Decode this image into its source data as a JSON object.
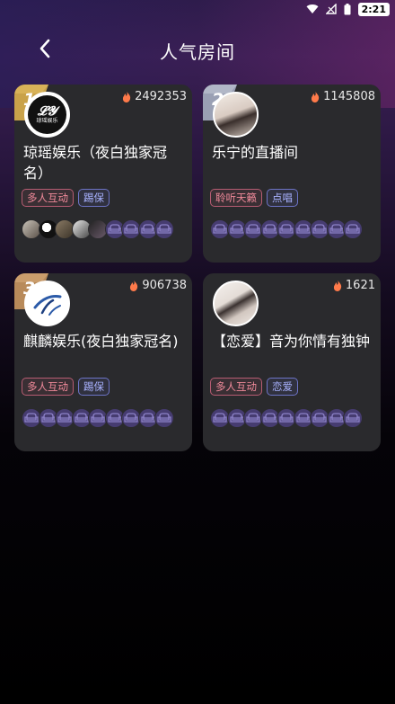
{
  "status_bar": {
    "time": "2:21"
  },
  "header": {
    "title": "人气房间"
  },
  "rooms": [
    {
      "rank": "1",
      "heat": "2492353",
      "title": "琼瑶娱乐（夜白独家冠名）",
      "tags": [
        "多人互动",
        "踢保"
      ],
      "avatar_text": "琼瑶娱乐"
    },
    {
      "rank": "2",
      "heat": "1145808",
      "title": "乐宁的直播间",
      "tags": [
        "聆听天籁",
        "点唱"
      ]
    },
    {
      "rank": "3",
      "heat": "906738",
      "title": "麒麟娱乐(夜白独家冠名)",
      "tags": [
        "多人互动",
        "踢保"
      ]
    },
    {
      "rank": "",
      "heat": "1621",
      "title": "【恋爱】音为你情有独钟",
      "tags": [
        "多人互动",
        "恋爱"
      ]
    }
  ],
  "icons": {
    "back": "chevron-left-icon",
    "heat": "flame-icon",
    "seat": "sofa-seat-icon",
    "wifi": "wifi-icon",
    "signal": "signal-icon",
    "battery": "battery-icon"
  },
  "colors": {
    "card_bg": "#2a2a2d",
    "tag_pink": "#f08a9a",
    "tag_blue": "#a9b2ff",
    "seat_bg": "#463c70",
    "rank_gold": "#c9a24a",
    "rank_silver": "#9aa0b4",
    "rank_bronze": "#b88a5a",
    "flame": "#ff7a4a"
  }
}
